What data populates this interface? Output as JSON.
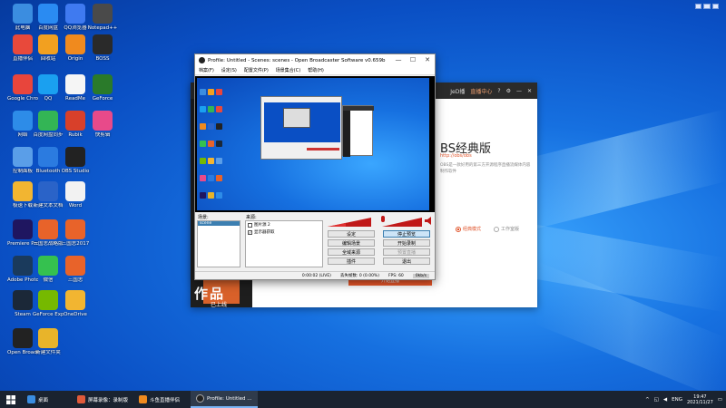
{
  "desktop_icons": [
    {
      "label": "此电脑",
      "color": "#3b8de0"
    },
    {
      "label": "百度网盘",
      "color": "#2a8bf2"
    },
    {
      "label": "QQ浏览器",
      "color": "#3f7af0"
    },
    {
      "label": "Notepad++",
      "color": "#4a4a4a"
    },
    {
      "label": "直播伴侣",
      "color": "#e8493b"
    },
    {
      "label": "回收站",
      "color": "#f2a020"
    },
    {
      "label": "Origin",
      "color": "#f08a1e"
    },
    {
      "label": "BOSS",
      "color": "#2a2a2a"
    },
    {
      "label": "Google Chrome",
      "color": "#e8453c"
    },
    {
      "label": "QQ",
      "color": "#1aa0f0"
    },
    {
      "label": "ReadMe",
      "color": "#f5f5f5"
    },
    {
      "label": "GeForce",
      "color": "#2a7a2a"
    },
    {
      "label": "网络",
      "color": "#2d8ce8"
    },
    {
      "label": "百度网盘同步",
      "color": "#33b555"
    },
    {
      "label": "Rubik",
      "color": "#d8402a"
    },
    {
      "label": "快剪辑",
      "color": "#e84a8a"
    },
    {
      "label": "控制面板",
      "color": "#5a9ee8"
    },
    {
      "label": "Bluetooth",
      "color": "#2b7be0"
    },
    {
      "label": "OBS Studio",
      "color": "#222222"
    },
    {
      "label": "极速下载",
      "color": "#f2b531"
    },
    {
      "label": "新建文本文档",
      "color": "#2a63c8"
    },
    {
      "label": "Word",
      "color": "#f2f2f2"
    },
    {
      "label": "Premiere Pro",
      "color": "#1f1660"
    },
    {
      "label": "三国志战略版",
      "color": "#e8632a"
    },
    {
      "label": "三国志2017",
      "color": "#e8632a"
    },
    {
      "label": "Adobe Photoshop",
      "color": "#1a3a5c"
    },
    {
      "label": "微信",
      "color": "#35c14f"
    },
    {
      "label": "三国志",
      "color": "#e8632a"
    },
    {
      "label": "Steam",
      "color": "#1b2838"
    },
    {
      "label": "GeForce Experience",
      "color": "#76b900"
    },
    {
      "label": "OneDrive",
      "color": "#f2b531"
    },
    {
      "label": "Open Broadcaster",
      "color": "#222222"
    },
    {
      "label": "新建文件夹",
      "color": "#e8b42a"
    }
  ],
  "obs": {
    "title": "Profile: Untitled - Scenes: scenes - Open Broadcaster Software v0.659b",
    "menu": [
      "档案(F)",
      "设定(S)",
      "配置文件(P)",
      "场景集合(C)",
      "帮助(H)"
    ],
    "scenes_label": "场景:",
    "scenes": [
      "scene"
    ],
    "sources_label": "来源:",
    "sources": [
      "图片源 2",
      "显示器获取"
    ],
    "buttons": [
      "设定",
      "停止预览",
      "编辑场景",
      "开始录制",
      "全域来源",
      "预置直播",
      "插件",
      "退出"
    ],
    "status_time": "0:00:02  (LIVE)",
    "status_drop": "丢失帧数: 0 (0.00%)",
    "status_fps": "FPS: 60",
    "status_rate": "0kb/s"
  },
  "livehime": {
    "user": "JeD播",
    "header_link": "直播中心",
    "title": "BS经典版",
    "link": "http://obs/obs",
    "desc": "OBS是一款好用的第三方开源程序直播流媒体内容制作软件",
    "radio_1": "经典模式",
    "radio_2": "工作室版",
    "left_text": "作品",
    "left_sub": "已上线",
    "start_btn": "开始直播"
  },
  "taskbar": {
    "items": [
      {
        "label": "桌面",
        "color": "#3a8de0"
      },
      {
        "label": "屏幕录像：录制版",
        "color": "#e05a3a"
      },
      {
        "label": "斗鱼直播伴侣",
        "color": "#f08a1e"
      },
      {
        "label": "Profile: Untitled ...",
        "color": "#222222"
      }
    ],
    "lang": "ENG",
    "time": "19:47",
    "date": "2021/11/27"
  }
}
